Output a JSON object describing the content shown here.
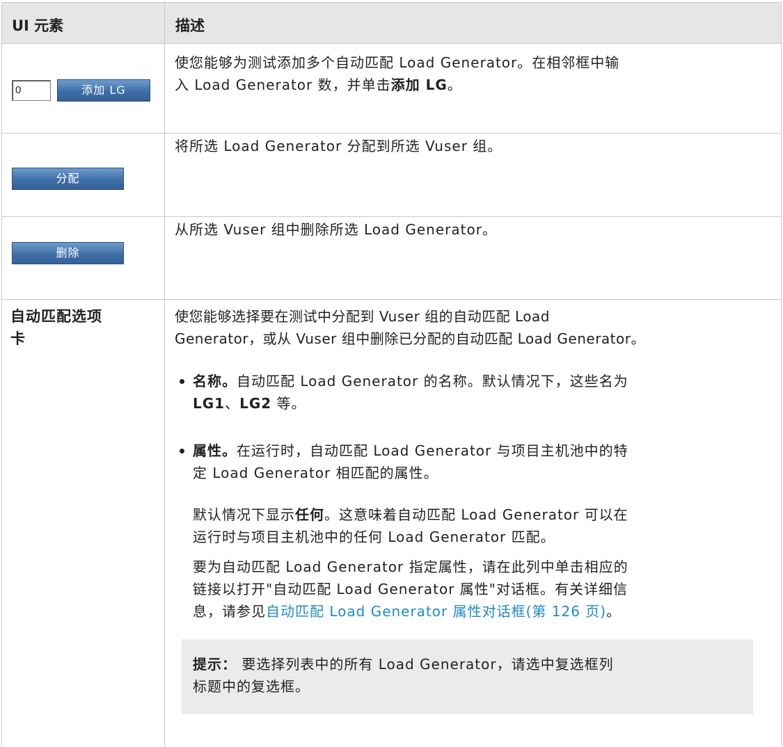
{
  "header": {
    "col1": "UI 元素",
    "col2": "描述"
  },
  "row_add": {
    "input_value": "0",
    "button_label": "添加 LG",
    "desc_line1": "使您能够为测试添加多个自动匹配 Load Generator。在相邻框中输",
    "desc_line2_pre": "入 Load Generator 数，并单击",
    "desc_line2_bold": "添加 LG",
    "desc_line2_post": "。"
  },
  "row_assign": {
    "button_label": "分配",
    "desc": "将所选 Load Generator 分配到所选 Vuser 组。"
  },
  "row_remove": {
    "button_label": "删除",
    "desc": "从所选 Vuser 组中删除所选 Load Generator。"
  },
  "row_tab": {
    "name_line1": "自动匹配选项",
    "name_line2": "卡",
    "intro_line1": "使您能够选择要在测试中分配到 Vuser 组的自动匹配 Load",
    "intro_line2": "Generator，或从 Vuser 组中删除已分配的自动匹配 Load Generator。",
    "name_bullet": {
      "term": "名称。",
      "line1": "自动匹配 Load Generator 的名称。默认情况下，这些名为",
      "line2_b1": "LG1",
      "line2_sep": "、",
      "line2_b2": "LG2",
      "line2_post": " 等。"
    },
    "attr_bullet": {
      "term": "属性。",
      "line1": "在运行时，自动匹配 Load Generator 与项目主机池中的特",
      "line2": "定 Load Generator 相匹配的属性。"
    },
    "default_para": {
      "line1_pre": "默认情况下显示",
      "line1_bold": "任何",
      "line1_post": "。这意味着自动匹配 Load Generator 可以在",
      "line2": "运行时与项目主机池中的任何 Load Generator 匹配。"
    },
    "specify_para": {
      "line1": "要为自动匹配 Load Generator 指定属性，请在此列中单击相应的",
      "line2": "链接以打开\"自动匹配 Load Generator 属性\"对话框。有关详细信",
      "line3_pre": "息，请参见",
      "link": "自动匹配 Load Generator 属性对话框(第 126 页)",
      "line3_post": "。"
    },
    "tip": {
      "label": "提示：",
      "line1": " 要选择列表中的所有 Load Generator，请选中复选框列",
      "line2": "标题中的复选框。"
    }
  },
  "colors": {
    "link": "#1f8ac9",
    "header_bg": "#e6e6e6",
    "tip_bg": "#ebebeb",
    "button_blue": "#3f6fa8"
  }
}
